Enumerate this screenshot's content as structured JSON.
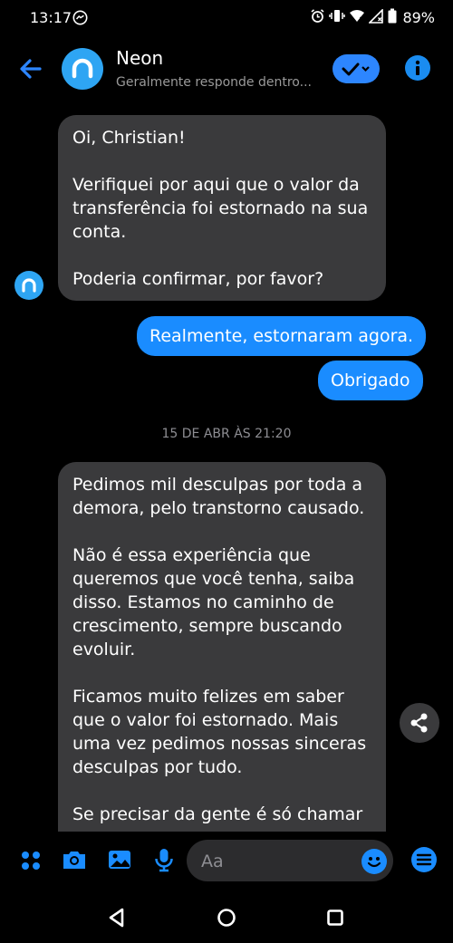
{
  "status_bar": {
    "time": "13:17",
    "battery": "89%"
  },
  "header": {
    "name": "Neon",
    "subtitle": "Geralmente responde dentro..."
  },
  "messages": {
    "incoming_1": [
      "Oi, Christian!",
      "Verifiquei por aqui que o valor da transferência foi estornado na sua conta.",
      "Poderia confirmar, por favor?"
    ],
    "outgoing_1": "Realmente, estornaram agora.",
    "outgoing_2": "Obrigado",
    "timestamp": "15 DE ABR ÀS 21:20",
    "incoming_2": [
      "Pedimos mil desculpas por toda a demora, pelo transtorno causado.",
      "Não é essa experiência que queremos que você tenha, saiba disso. Estamos no caminho de crescimento, sempre buscando evoluir.",
      "Ficamos muito felizes em saber que o valor foi estornado. Mais uma vez pedimos nossas sinceras desculpas por tudo.",
      "Se precisar da gente é só chamar"
    ]
  },
  "composer": {
    "placeholder": "Aa"
  },
  "colors": {
    "accent": "#1a8cff",
    "bubble_incoming": "#3a3a3c",
    "background": "#000000"
  },
  "icons": {
    "back": "arrow-left-icon",
    "check": "check-icon",
    "info": "info-icon",
    "share": "share-icon",
    "more": "grid-dots-icon",
    "camera": "camera-icon",
    "gallery": "image-icon",
    "mic": "microphone-icon",
    "emoji": "emoji-icon",
    "menu": "menu-icon"
  }
}
